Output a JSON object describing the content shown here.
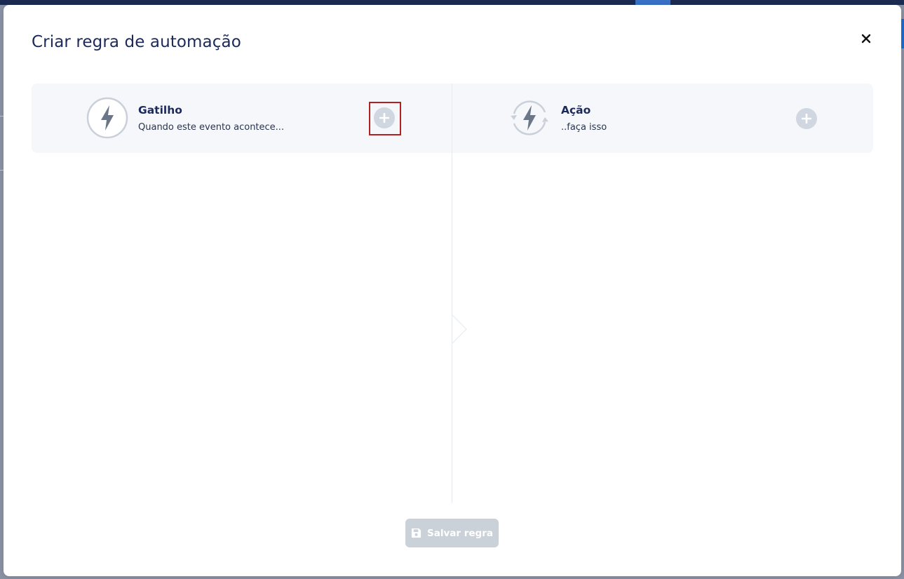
{
  "modal": {
    "title": "Criar regra de automação",
    "close_icon": "close-icon"
  },
  "trigger": {
    "title": "Gatilho",
    "subtitle": "Quando este evento acontece...",
    "icon": "lightning-bolt-icon",
    "add_icon": "plus-circle-icon"
  },
  "action": {
    "title": "Ação",
    "subtitle": "..faça isso",
    "icon": "lightning-bolt-cycle-icon",
    "add_icon": "plus-circle-icon"
  },
  "footer": {
    "save_label": "Salvar regra",
    "save_icon": "floppy-disk-icon",
    "save_disabled": true
  },
  "colors": {
    "title": "#1b2a5b",
    "strip_bg": "#f5f7fa",
    "add_button": "#d1d7e0",
    "highlight": "#b22222",
    "save_disabled_bg": "#cbd1d8"
  }
}
